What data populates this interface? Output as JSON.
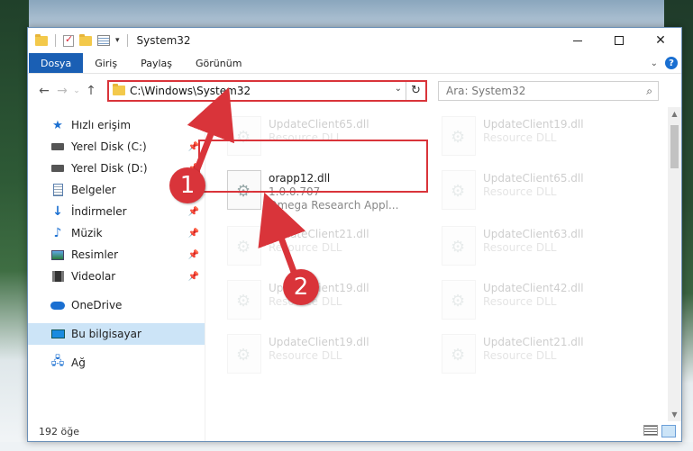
{
  "window": {
    "title": "System32",
    "controls": {
      "minimize": "",
      "maximize": "",
      "close": "✕"
    }
  },
  "ribbon": {
    "tabs": [
      "Dosya",
      "Giriş",
      "Paylaş",
      "Görünüm"
    ],
    "active_tab": "Dosya",
    "help_label": "?"
  },
  "address": {
    "path": "C:\\Windows\\System32",
    "search_placeholder": "Ara: System32"
  },
  "nav": {
    "items": [
      {
        "label": "Hızlı erişim",
        "icon": "star-icon",
        "pinned": false
      },
      {
        "label": "Yerel Disk (C:)",
        "icon": "disk-icon",
        "pinned": true
      },
      {
        "label": "Yerel Disk (D:)",
        "icon": "disk-icon",
        "pinned": true
      },
      {
        "label": "Belgeler",
        "icon": "document-icon",
        "pinned": true
      },
      {
        "label": "İndirmeler",
        "icon": "download-icon",
        "pinned": true
      },
      {
        "label": "Müzik",
        "icon": "music-icon",
        "pinned": true
      },
      {
        "label": "Resimler",
        "icon": "pictures-icon",
        "pinned": true
      },
      {
        "label": "Videolar",
        "icon": "videos-icon",
        "pinned": true
      },
      {
        "label": "OneDrive",
        "icon": "cloud-icon",
        "pinned": false
      },
      {
        "label": "Bu bilgisayar",
        "icon": "computer-icon",
        "pinned": false,
        "selected": true
      },
      {
        "label": "Ağ",
        "icon": "network-icon",
        "pinned": false
      }
    ]
  },
  "files": [
    {
      "name": "UpdateClient65.dll",
      "type": "Resource DLL",
      "faded": true
    },
    {
      "name": "UpdateClient19.dll",
      "type": "Resource DLL",
      "faded": true
    },
    {
      "name": "orapp12.dll",
      "version": "1.0.0.707",
      "company": "Omega Research Appl...",
      "faded": false,
      "highlighted": true
    },
    {
      "name": "UpdateClient65.dll",
      "type": "Resource DLL",
      "faded": true
    },
    {
      "name": "UpdateClient21.dll",
      "type": "Resource DLL",
      "faded": true
    },
    {
      "name": "UpdateClient63.dll",
      "type": "Resource DLL",
      "faded": true
    },
    {
      "name": "UpdateClient19.dll",
      "type": "Resource DLL",
      "faded": true
    },
    {
      "name": "UpdateClient42.dll",
      "type": "Resource DLL",
      "faded": true
    },
    {
      "name": "UpdateClient19.dll",
      "type": "Resource DLL",
      "faded": true
    },
    {
      "name": "UpdateClient21.dll",
      "type": "Resource DLL",
      "faded": true
    }
  ],
  "status": {
    "item_count": "192 öğe"
  },
  "annotations": {
    "step1": "1",
    "step2": "2",
    "color": "#d9343a"
  }
}
